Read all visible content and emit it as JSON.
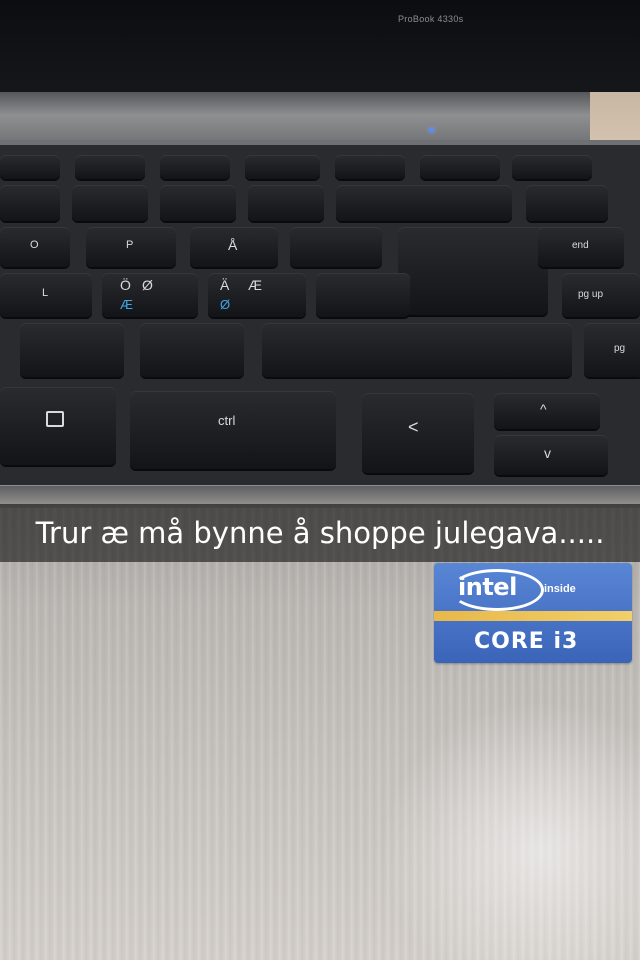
{
  "photo": {
    "screen_model": "ProBook 4330s",
    "caption": "Trur æ må bynne å shoppe julegava.....",
    "keys": {
      "o": "O",
      "p": "P",
      "a_ring": "Å",
      "o_umlaut": "Ö",
      "o_slash": "Ø",
      "a_umlaut": "Ä",
      "ae": "Æ",
      "l": "L",
      "ctrl": "ctrl",
      "lt": "<",
      "end": "end",
      "pgup": "pg up",
      "pgdn": "pg",
      "up": "^",
      "down": "v"
    },
    "sticker": {
      "brand": "intel",
      "inside": "inside",
      "core": "CORE i3"
    }
  }
}
